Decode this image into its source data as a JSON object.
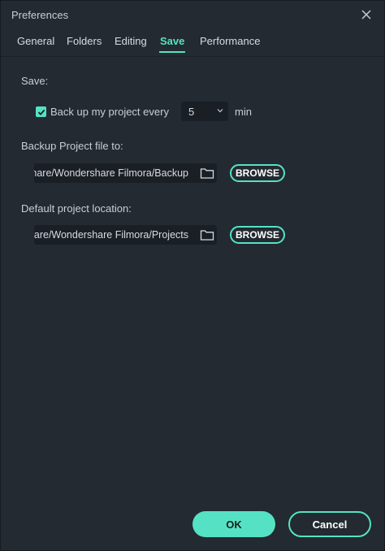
{
  "window": {
    "title": "Preferences"
  },
  "tabs": [
    {
      "label": "General"
    },
    {
      "label": "Folders"
    },
    {
      "label": "Editing"
    },
    {
      "label": "Save",
      "active": true
    },
    {
      "label": "Performance"
    }
  ],
  "save": {
    "section_label": "Save:",
    "backup_checkbox_label": "Back up my project every",
    "backup_checked": true,
    "interval_value": "5",
    "interval_unit": "min"
  },
  "backup_location": {
    "label": "Backup Project file to:",
    "path": "C:/Users/Public/Documents/Wondershare/Wondershare Filmora/Backup",
    "browse_label": "BROWSE"
  },
  "default_location": {
    "label": "Default project location:",
    "path": "C:/Users/Public/Documents/Wondershare/Wondershare Filmora/Projects",
    "browse_label": "BROWSE"
  },
  "footer": {
    "ok_label": "OK",
    "cancel_label": "Cancel"
  },
  "colors": {
    "accent": "#55e2c4",
    "background": "#232a31",
    "field": "#1a1f25"
  },
  "icons": {
    "close": "close-icon",
    "folder": "folder-icon",
    "check": "check-icon",
    "chevron": "chevron-down-icon"
  }
}
